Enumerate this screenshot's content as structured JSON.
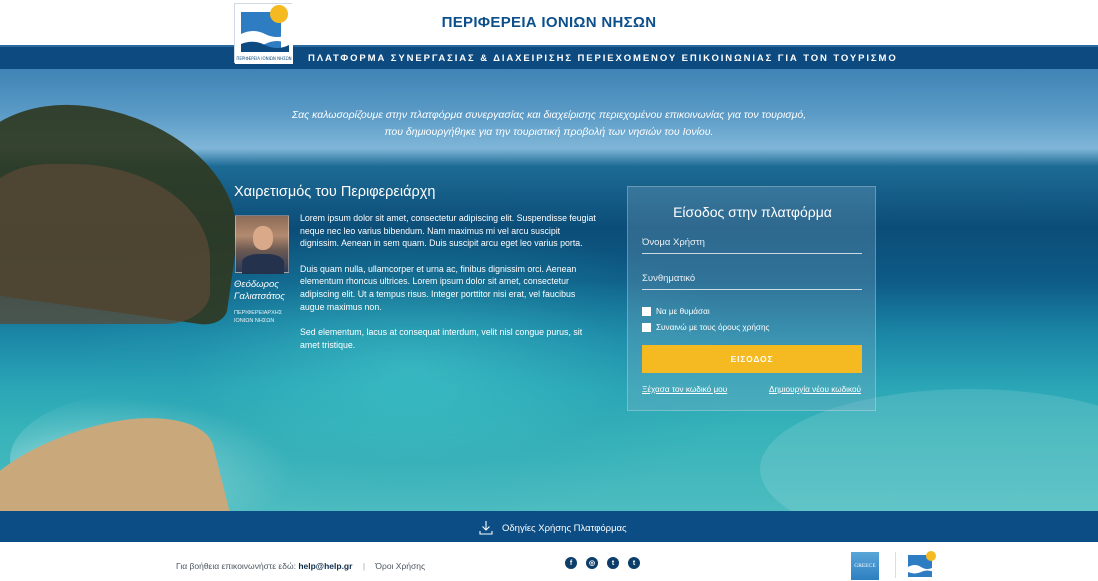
{
  "header": {
    "region_title": "ΠΕΡΙΦΕΡΕΙΑ ΙΟΝΙΩΝ ΝΗΣΩΝ",
    "platform_subtitle": "ΠΛΑΤΦΟΡΜΑ ΣΥΝΕΡΓΑΣΙΑΣ & ΔΙΑΧΕΙΡΙΣΗΣ ΠΕΡΙΕΧΟΜΕΝΟΥ ΕΠΙΚΟΙΝΩΝΙΑΣ ΓΙΑ ΤΟΝ ΤΟΥΡΙΣΜΟ",
    "logo_text": "ΠΕΡΙΦΕΡΕΙΑ ΙΟΝΙΩΝ ΝΗΣΩΝ"
  },
  "hero": {
    "welcome_line1": "Σας καλωσορίζουμε στην πλατφόρμα συνεργασίας και διαχείρισης περιεχομένου επικοινωνίας για τον τουρισμό,",
    "welcome_line2": "που δημιουργήθηκε για την τουριστική προβολή των νησιών του Ιονίου."
  },
  "greeting": {
    "title": "Χαιρετισμός του Περιφερειάρχη",
    "person_name": "Θεόδωρος Γαλιατσάτος",
    "person_role": "ΠΕΡΙΦΕΡΕΙΑΡΧΗΣ ΙΟΝΙΩΝ ΝΗΣΩΝ",
    "paragraphs": [
      "Lorem ipsum dolor sit amet, consectetur adipiscing elit. Suspendisse feugiat neque nec leo varius bibendum. Nam maximus mi vel arcu suscipit dignissim. Aenean in sem quam. Duis suscipit arcu eget leo varius porta.",
      "Duis quam nulla, ullamcorper et urna ac, finibus dignissim orci. Aenean elementum rhoncus ultrices. Lorem ipsum dolor sit amet, consectetur adipiscing elit. Ut a tempus risus. Integer porttitor nisi erat, vel faucibus augue maximus non.",
      "Sed elementum, lacus at consequat interdum, velit nisl congue purus, sit amet tristique."
    ]
  },
  "login": {
    "title": "Είσοδος στην πλατφόρμα",
    "username_placeholder": "Όνομα Χρήστη",
    "password_placeholder": "Συνθηματικό",
    "remember_label": "Να με θυμάσαι",
    "terms_label": "Συναινώ με τους όρους χρήσης",
    "submit_label": "ΕΙΣΟΔΟΣ",
    "forgot_link": "Ξέχασα τον κωδικό μου",
    "new_code_link": "Δημιουργία νέου κωδικού"
  },
  "instructions": {
    "label": "Οδηγίες Χρήσης Πλατφόρμας",
    "icon": "download-icon"
  },
  "footer": {
    "help_text": "Για βοήθεια επικοινωνήστε εδώ:",
    "help_email": "help@help.gr",
    "separator": "|",
    "terms_link": "Όροι Χρήσης",
    "socials": [
      {
        "name": "facebook-icon",
        "glyph": "f"
      },
      {
        "name": "instagram-icon",
        "glyph": "◎"
      },
      {
        "name": "twitter-icon",
        "glyph": "t"
      },
      {
        "name": "tumblr-icon",
        "glyph": "t"
      }
    ],
    "greece_badge": "GREECE"
  },
  "colors": {
    "brand_blue": "#0d4a80",
    "accent_yellow": "#f5b921"
  }
}
